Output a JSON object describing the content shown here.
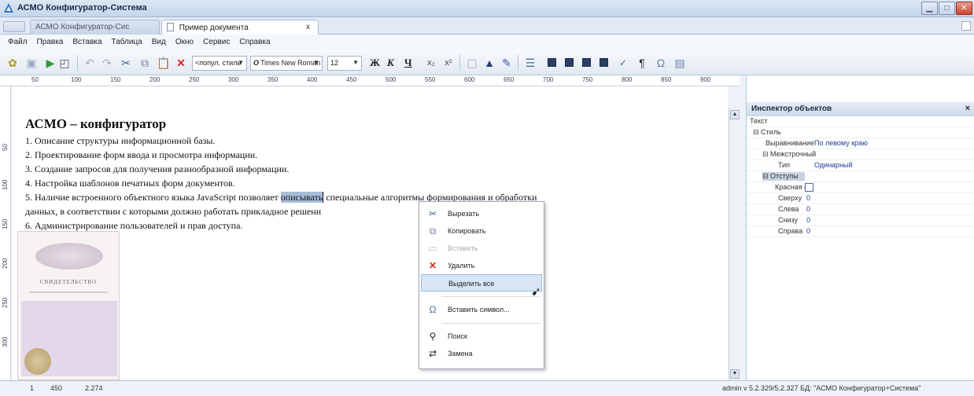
{
  "window": {
    "title": "АСМО Конфигуратор-Система"
  },
  "tabs": [
    {
      "label": "АСМО Конфигуратор-Сис"
    },
    {
      "label": "Пример документа",
      "close": "x"
    }
  ],
  "menu": [
    "Файл",
    "Правка",
    "Вставка",
    "Таблица",
    "Вид",
    "Окно",
    "Сервис",
    "Справка"
  ],
  "toolbar": {
    "style_value": "<попул. стиль",
    "font_value": "Times New Roman",
    "size_value": "12",
    "bold": "Ж",
    "italic": "К",
    "underline": "Ч"
  },
  "ruler": [
    "50",
    "100",
    "150",
    "200",
    "250",
    "300",
    "350",
    "400",
    "450",
    "500",
    "550",
    "600",
    "650",
    "700",
    "750",
    "800",
    "850",
    "900"
  ],
  "vruler": [
    "50",
    "100",
    "150",
    "200",
    "250",
    "300"
  ],
  "document": {
    "heading": "АСМО – конфигуратор",
    "lines": [
      "1. Описание структуры информационной базы.",
      "2. Проектирование форм ввода и просмотра информации.",
      "3. Создание запросов для получения разнообразной информации.",
      "4. Настройка шаблонов печатных форм документов.",
      "данных, в соответствии с которыми должно работать прикладное решени",
      "6. Администрирование пользователей и прав доступа."
    ],
    "line5_before": "5. Наличие встроенного объектного языка JavaScript позволяет ",
    "line5_selected": "описывать",
    "line5_after": " специальные алгоритмы формирования и обработки",
    "certificate_title": "СВИДЕТЕЛЬСТВО"
  },
  "context_menu": {
    "cut": "Вырезать",
    "copy": "Копировать",
    "paste": "Вставить",
    "delete": "Удалить",
    "select_all": "Выделить все",
    "insert_symbol": "Вставить символ...",
    "find": "Поиск",
    "replace": "Замена"
  },
  "inspector": {
    "title": "Инспектор объектов",
    "close": "×",
    "rows": {
      "text": "Текст",
      "style": "Стиль",
      "align_name": "Выравнивание",
      "align_value": "По левому краю",
      "spacing": "Межстрочный",
      "type_name": "Тип",
      "type_value": "Одинарный",
      "indents": "Отступы",
      "first_line": "Красная с",
      "top": "Сверху",
      "top_val": "0",
      "left": "Слева",
      "left_val": "0",
      "bottom": "Снизу",
      "bottom_val": "0",
      "right": "Справа",
      "right_val": "0"
    }
  },
  "status": {
    "page": "1",
    "zoom": "450",
    "position": "2.274",
    "info": "admin  v 5.2.329/5.2.327  БД: \"АСМО Конфигуратор+Система\""
  },
  "colors": {
    "accent": "#1f3f9a",
    "selection": "#a9bcd7",
    "menu_hover": "#d7e5f6"
  }
}
